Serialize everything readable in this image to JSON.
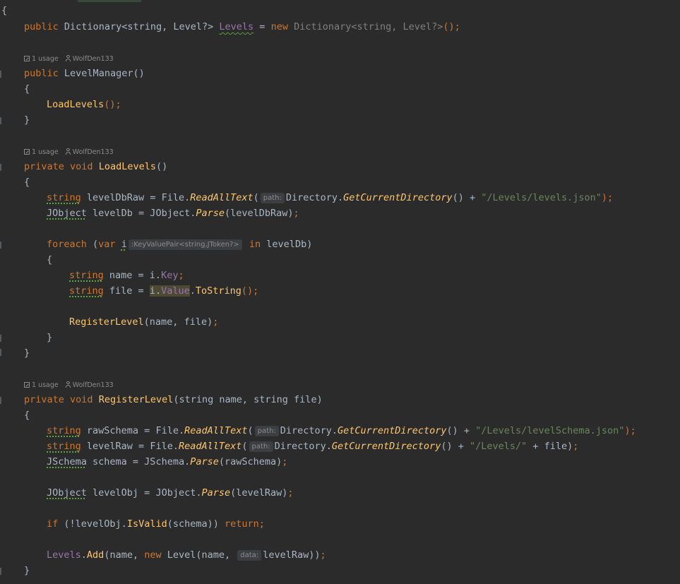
{
  "editor": {
    "usage_hint": "1 usage",
    "author_hint": "WolfDen133",
    "lines": {
      "l1_open": "{",
      "l2_public": "public",
      "l2_type": "Dictionary<string, Level?>",
      "l2_field": "Levels",
      "l2_eq": " = ",
      "l2_new": "new",
      "l2_newtype": "Dictionary<string, Level?>",
      "l2_end": "();",
      "l3_public": "public",
      "l3_ctor": "LevelManager",
      "l3_parens": "()",
      "l4_open": "{",
      "l5_call": "LoadLevels",
      "l5_end": "();",
      "l6_close": "}",
      "l7_private": "private",
      "l7_void": "void",
      "l7_name": "LoadLevels",
      "l7_parens": "()",
      "l8_open": "{",
      "l9_string": "string",
      "l9_var": " levelDbRaw = File.",
      "l9_method": "ReadAllText",
      "l9_paren": "(",
      "l9_hint": "path:",
      "l9_dir": "Directory.",
      "l9_getdir": "GetCurrentDirectory",
      "l9_plus": "() + ",
      "l9_str": "\"/Levels/levels.json\"",
      "l9_end": ");",
      "l10_type": "JObject",
      "l10_var": " levelDb = JObject.",
      "l10_method": "Parse",
      "l10_args": "(levelDbRaw)",
      "l10_end": ";",
      "l11_foreach": "foreach",
      "l11_open": " (",
      "l11_var": "var",
      "l11_i": "i",
      "l11_hint": ":KeyValuePair<string,JToken?>",
      "l11_in": "in",
      "l11_rest": " levelDb)",
      "l12_open": "{",
      "l13_string": "string",
      "l13_var": " name = i.",
      "l13_prop": "Key",
      "l13_end": ";",
      "l14_string": "string",
      "l14_var": " file = ",
      "l14_i": "i.",
      "l14_prop": "Value",
      "l14_dot": ".",
      "l14_method": "ToString",
      "l14_end": "();",
      "l15_call": "RegisterLevel",
      "l15_args": "(name, file)",
      "l15_end": ";",
      "l16_close": "}",
      "l17_close": "}",
      "l18_private": "private",
      "l18_void": "void",
      "l18_name": "RegisterLevel",
      "l18_params": "(string name, string file)",
      "l19_open": "{",
      "l20_string": "string",
      "l20_var": " rawSchema = File.",
      "l20_method": "ReadAllText",
      "l20_paren": "(",
      "l20_hint": "path:",
      "l20_dir": "Directory.",
      "l20_getdir": "GetCurrentDirectory",
      "l20_plus": "() + ",
      "l20_str": "\"/Levels/levelSchema.json\"",
      "l20_end": ");",
      "l21_string": "string",
      "l21_var": " levelRaw = File.",
      "l21_method": "ReadAllText",
      "l21_paren": "(",
      "l21_hint": "path:",
      "l21_dir": "Directory.",
      "l21_getdir": "GetCurrentDirectory",
      "l21_plus": "() + ",
      "l21_str": "\"/Levels/\"",
      "l21_tail": " + file)",
      "l21_end": ";",
      "l22_type": "JSchema",
      "l22_var": " schema = JSchema.",
      "l22_method": "Parse",
      "l22_args": "(rawSchema)",
      "l22_end": ";",
      "l23_type": "JObject",
      "l23_var": " levelObj = JObject.",
      "l23_method": "Parse",
      "l23_args": "(levelRaw)",
      "l23_end": ";",
      "l24_if": "if",
      "l24_cond": " (!levelObj.",
      "l24_method": "IsValid",
      "l24_args": "(schema)) ",
      "l24_return": "return",
      "l24_end": ";",
      "l25_field": "Levels",
      "l25_dot": ".",
      "l25_method": "Add",
      "l25_args1": "(name, ",
      "l25_new": "new",
      "l25_type": " Level(name, ",
      "l25_hint": "data:",
      "l25_args2": "levelRaw))",
      "l25_end": ";",
      "l26_close": "}"
    }
  }
}
